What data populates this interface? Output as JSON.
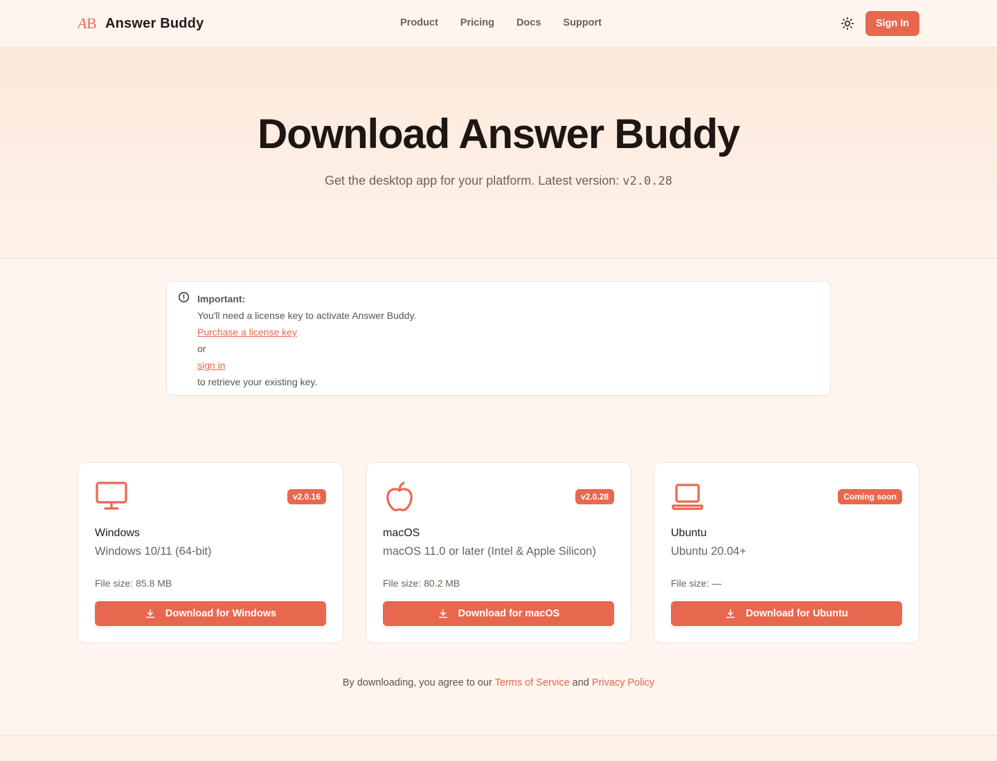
{
  "brand": {
    "logo_mark": "AB",
    "name": "Answer Buddy",
    "accent": "#e8684f"
  },
  "nav": {
    "items": [
      "Product",
      "Pricing",
      "Docs",
      "Support"
    ]
  },
  "header": {
    "theme_icon": "sun-icon",
    "signin_label": "Sign In"
  },
  "hero": {
    "title": "Download Answer Buddy",
    "subtitle": "Get the desktop app for your platform. Latest version:",
    "version": "v2.0.28"
  },
  "notice": {
    "icon": "alert-circle-icon",
    "heading": "Important:",
    "line1": "You'll need a license key to activate Answer Buddy.",
    "purchase_link": "Purchase a license key",
    "or": "or",
    "signin_link": "sign in",
    "line_end": "to retrieve your existing key."
  },
  "platforms": [
    {
      "icon": "monitor-icon",
      "badge": "v2.0.16",
      "name": "Windows",
      "requirements": "Windows 10/11 (64-bit)",
      "file_size": "File size: 85.8 MB",
      "button": "Download for Windows"
    },
    {
      "icon": "apple-icon",
      "badge": "v2.0.28",
      "name": "macOS",
      "requirements": "macOS 11.0 or later (Intel & Apple Silicon)",
      "file_size": "File size: 80.2 MB",
      "button": "Download for macOS"
    },
    {
      "icon": "laptop-icon",
      "badge": "Coming soon",
      "name": "Ubuntu",
      "requirements": "Ubuntu 20.04+",
      "file_size": "File size: —",
      "button": "Download for Ubuntu"
    }
  ],
  "legal": {
    "prefix": "By downloading, you agree to our",
    "terms": "Terms of Service",
    "and": "and",
    "privacy": "Privacy Policy"
  }
}
